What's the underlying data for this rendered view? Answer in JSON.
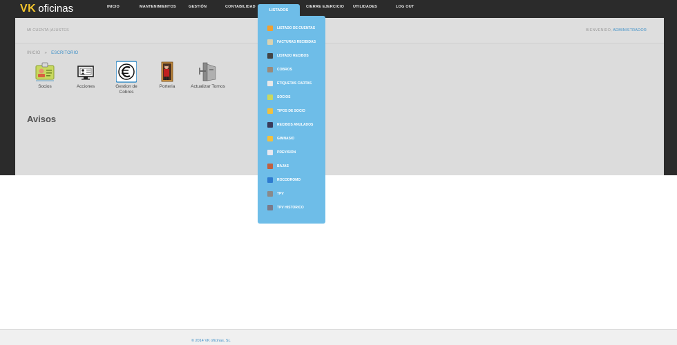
{
  "app": {
    "logo_vk": "VK",
    "logo_name": "oficinas"
  },
  "nav": {
    "items": [
      {
        "label": "INICIO"
      },
      {
        "label": "MANTENIMIENTOS"
      },
      {
        "label": "GESTIÓN"
      },
      {
        "label": "CONTABILIDAD"
      },
      {
        "label": "LISTADOS"
      },
      {
        "label": "CIERRE EJERCICIO"
      },
      {
        "label": "UTILIDADES"
      },
      {
        "label": "LOG OUT"
      }
    ]
  },
  "account": {
    "micuenta": "MI CUENTA |AJUSTES",
    "welcome": "BIENVENIDO,",
    "user": "ADMINISTRADOR"
  },
  "breadcrumb": {
    "home": "INICIO",
    "separator": "»",
    "current": "ESCRITORIO"
  },
  "shortcuts": [
    {
      "label": "Socios",
      "icon": "member-card-icon"
    },
    {
      "label": "Acciones",
      "icon": "presentation-icon"
    },
    {
      "label": "Gestion de Cobros",
      "icon": "euro-icon"
    },
    {
      "label": "Porteria",
      "icon": "doorman-icon"
    },
    {
      "label": "Actualizar Tornos",
      "icon": "turnstile-icon"
    }
  ],
  "section_title": "Avisos",
  "dropdown": {
    "items": [
      {
        "label": "LISTADO DE CUENTAS",
        "icon": "pencil-icon",
        "color": "#f0a030"
      },
      {
        "label": "FACTURAS RECIBIDAS",
        "icon": "invoice-icon",
        "color": "#d9d2b0"
      },
      {
        "label": "LISTADO RECIBOS",
        "icon": "receipt-icon",
        "color": "#444444"
      },
      {
        "label": "COBROS",
        "icon": "coins-icon",
        "color": "#9a8a7a"
      },
      {
        "label": "ETIQUETAS CARTAS",
        "icon": "label-icon",
        "color": "#e8e8e8"
      },
      {
        "label": "SOCIOS",
        "icon": "member-card-icon",
        "color": "#c8d860"
      },
      {
        "label": "TIPOS DE SOCIO",
        "icon": "member-types-icon",
        "color": "#f0c040"
      },
      {
        "label": "RECIBOS ANULADOS",
        "icon": "cancelled-receipt-icon",
        "color": "#3a3a5a"
      },
      {
        "label": "GIMNASIO",
        "icon": "gym-icon",
        "color": "#f0c040"
      },
      {
        "label": "PREVISION",
        "icon": "forecast-icon",
        "color": "#e8e8f0"
      },
      {
        "label": "BAJAS",
        "icon": "leave-icon",
        "color": "#c06040"
      },
      {
        "label": "ROCODROMO",
        "icon": "climbing-icon",
        "color": "#2e7bd0"
      },
      {
        "label": "TPV",
        "icon": "pos-terminal-icon",
        "color": "#8a8a8a"
      },
      {
        "label": "TPV HISTORICO",
        "icon": "pos-history-icon",
        "color": "#7a7a8a"
      }
    ]
  },
  "footer": {
    "text": "© 2014 VK oficinas, SL"
  }
}
